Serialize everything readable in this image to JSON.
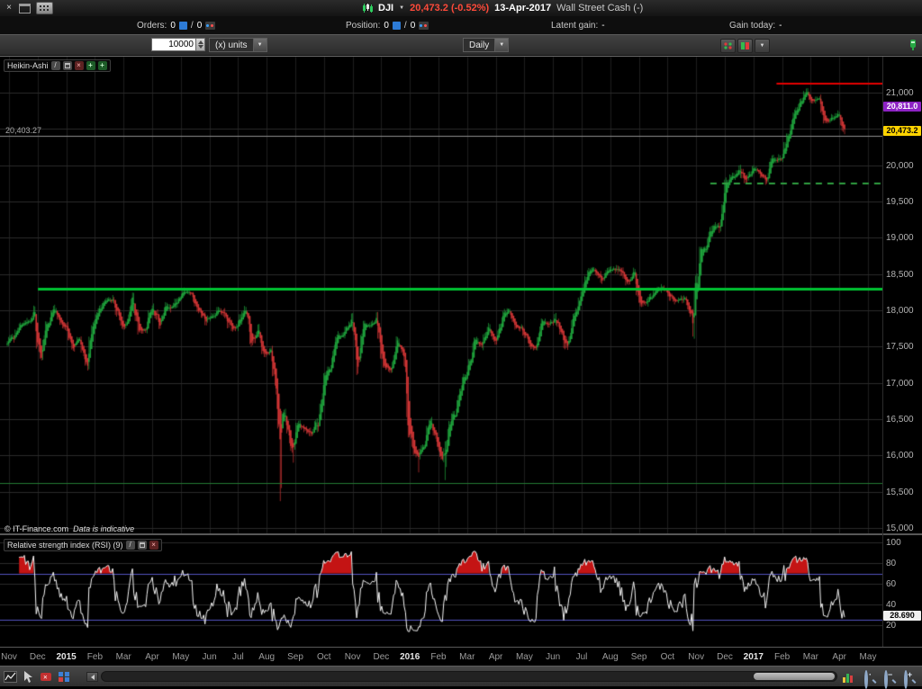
{
  "titlebar": {
    "symbol": "DJI",
    "price_change": "20,473.2 (-0.52%)",
    "date": "13-Apr-2017",
    "market": "Wall Street Cash (-)"
  },
  "status_row": {
    "orders": {
      "label": "Orders:",
      "value": "0",
      "separator": "/",
      "value2": "0"
    },
    "position": {
      "label": "Position:",
      "value": "0",
      "separator": "/",
      "value2": "0"
    },
    "latent_gain": {
      "label": "Latent gain:",
      "value": "-"
    },
    "gain_today": {
      "label": "Gain today:",
      "value": "-"
    }
  },
  "toolbar": {
    "quantity": "10000",
    "units_label": "(x) units",
    "timeframe": "Daily"
  },
  "chart": {
    "style_label": "Heikin-Ashi",
    "rsi_header": "Relative strength index (RSI) (9)",
    "level_label": "20,403.27",
    "copyright": "© IT-Finance.com",
    "copyright_note": "Data is indicative",
    "badges": {
      "order_price": "20,811.0",
      "last_price": "20,473.2",
      "rsi_value": "28.690"
    },
    "y_axis": [
      {
        "label": "21,000",
        "value": 21000
      },
      {
        "label": "20,000",
        "value": 20000
      },
      {
        "label": "19,500",
        "value": 19500
      },
      {
        "label": "19,000",
        "value": 19000
      },
      {
        "label": "18,500",
        "value": 18500
      },
      {
        "label": "18,000",
        "value": 18000
      },
      {
        "label": "17,500",
        "value": 17500
      },
      {
        "label": "17,000",
        "value": 17000
      },
      {
        "label": "16,500",
        "value": 16500
      },
      {
        "label": "16,000",
        "value": 16000
      },
      {
        "label": "15,500",
        "value": 15500
      },
      {
        "label": "15,000",
        "value": 15000
      }
    ],
    "rsi_y_axis": [
      {
        "label": "100",
        "value": 100
      },
      {
        "label": "80",
        "value": 80
      },
      {
        "label": "60",
        "value": 60
      },
      {
        "label": "40",
        "value": 40
      },
      {
        "label": "20",
        "value": 20
      }
    ],
    "x_axis": [
      {
        "label": "Nov",
        "bold": false
      },
      {
        "label": "Dec",
        "bold": false
      },
      {
        "label": "2015",
        "bold": true
      },
      {
        "label": "Feb",
        "bold": false
      },
      {
        "label": "Mar",
        "bold": false
      },
      {
        "label": "Apr",
        "bold": false
      },
      {
        "label": "May",
        "bold": false
      },
      {
        "label": "Jun",
        "bold": false
      },
      {
        "label": "Jul",
        "bold": false
      },
      {
        "label": "Aug",
        "bold": false
      },
      {
        "label": "Sep",
        "bold": false
      },
      {
        "label": "Oct",
        "bold": false
      },
      {
        "label": "Nov",
        "bold": false
      },
      {
        "label": "Dec",
        "bold": false
      },
      {
        "label": "2016",
        "bold": true
      },
      {
        "label": "Feb",
        "bold": false
      },
      {
        "label": "Mar",
        "bold": false
      },
      {
        "label": "Apr",
        "bold": false
      },
      {
        "label": "May",
        "bold": false
      },
      {
        "label": "Jun",
        "bold": false
      },
      {
        "label": "Jul",
        "bold": false
      },
      {
        "label": "Aug",
        "bold": false
      },
      {
        "label": "Sep",
        "bold": false
      },
      {
        "label": "Oct",
        "bold": false
      },
      {
        "label": "Nov",
        "bold": false
      },
      {
        "label": "Dec",
        "bold": false
      },
      {
        "label": "2017",
        "bold": true
      },
      {
        "label": "Feb",
        "bold": false
      },
      {
        "label": "Mar",
        "bold": false
      },
      {
        "label": "Apr",
        "bold": false
      },
      {
        "label": "May",
        "bold": false
      }
    ]
  },
  "chart_data": {
    "type": "candlestick",
    "subtype": "heikin-ashi",
    "symbol": "DJI",
    "timeframe": "Daily",
    "x_range": [
      "Nov 2014",
      "May 2017"
    ],
    "y_range": [
      15000,
      21500
    ],
    "weekly_closes": [
      17574,
      17635,
      17810,
      17828,
      17959,
      17281,
      17805,
      18054,
      17833,
      17737,
      17512,
      17673,
      17165,
      17824,
      18019,
      18140,
      18133,
      17857,
      17749,
      18128,
      17713,
      17763,
      18058,
      17826,
      18058,
      18024,
      18191,
      18272,
      18232,
      18011,
      17849,
      17899,
      18014,
      17947,
      17730,
      17760,
      18086,
      17569,
      17690,
      17373,
      17477,
      16460,
      16643,
      16102,
      16433,
      16385,
      16315,
      16472,
      17084,
      17216,
      17647,
      17664,
      17910,
      17245,
      17824,
      17798,
      17848,
      17265,
      17128,
      17552,
      17425,
      16346,
      15988,
      16094,
      16466,
      16205,
      15974,
      16392,
      16640,
      17007,
      17213,
      17602,
      17516,
      17793,
      17577,
      17897,
      18004,
      17774,
      17741,
      17535,
      17500,
      17873,
      17807,
      17865,
      17675,
      17400,
      17949,
      18147,
      18517,
      18571,
      18432,
      18543,
      18576,
      18553,
      18395,
      18492,
      18085,
      18123,
      18261,
      18308,
      18240,
      18138,
      18146,
      18161,
      17888,
      18848,
      18868,
      19152,
      19170,
      19757,
      19843,
      19934,
      19763,
      19964,
      19886,
      19827,
      20094,
      20071,
      20269,
      20624,
      20822,
      21006,
      20903,
      20915,
      20597,
      20663,
      20656,
      20453
    ],
    "spike_lows": [
      [
        41,
        15370
      ],
      [
        43,
        15900
      ],
      [
        62,
        15766
      ],
      [
        66,
        15660
      ]
    ],
    "levels": [
      {
        "name": "resistance",
        "price": 21130,
        "color": "#e40000",
        "width": 2,
        "from": 0.88,
        "to": 1.0,
        "dash": false
      },
      {
        "name": "major-support",
        "price": 18300,
        "color": "#00c232",
        "width": 3,
        "from": 0.043,
        "to": 1.0,
        "dash": false
      },
      {
        "name": "breakout-support",
        "price": 19750,
        "color": "#2f9e41",
        "width": 2,
        "from": 0.805,
        "to": 1.0,
        "dash": true
      },
      {
        "name": "lower-support",
        "price": 15620,
        "color": "#237a33",
        "width": 1,
        "from": 0.0,
        "to": 1.0,
        "dash": false
      },
      {
        "name": "price-level",
        "price": 20403.27,
        "color": "#8f8f8f",
        "width": 1,
        "from": 0.0,
        "to": 1.0,
        "dash": false,
        "behind": true
      }
    ],
    "rsi": {
      "period": 9,
      "upper_threshold": 70,
      "lower_threshold": 25,
      "last_value": 28.69
    },
    "colors": {
      "up": "#1fa33c",
      "down": "#d03535",
      "rsi_line": "#f5f5f5",
      "rsi_fill": "#c41414",
      "rsi_threshold": "#5353c0",
      "grid": "#2b2b2b",
      "month_grid": "#1e1e1e"
    }
  }
}
